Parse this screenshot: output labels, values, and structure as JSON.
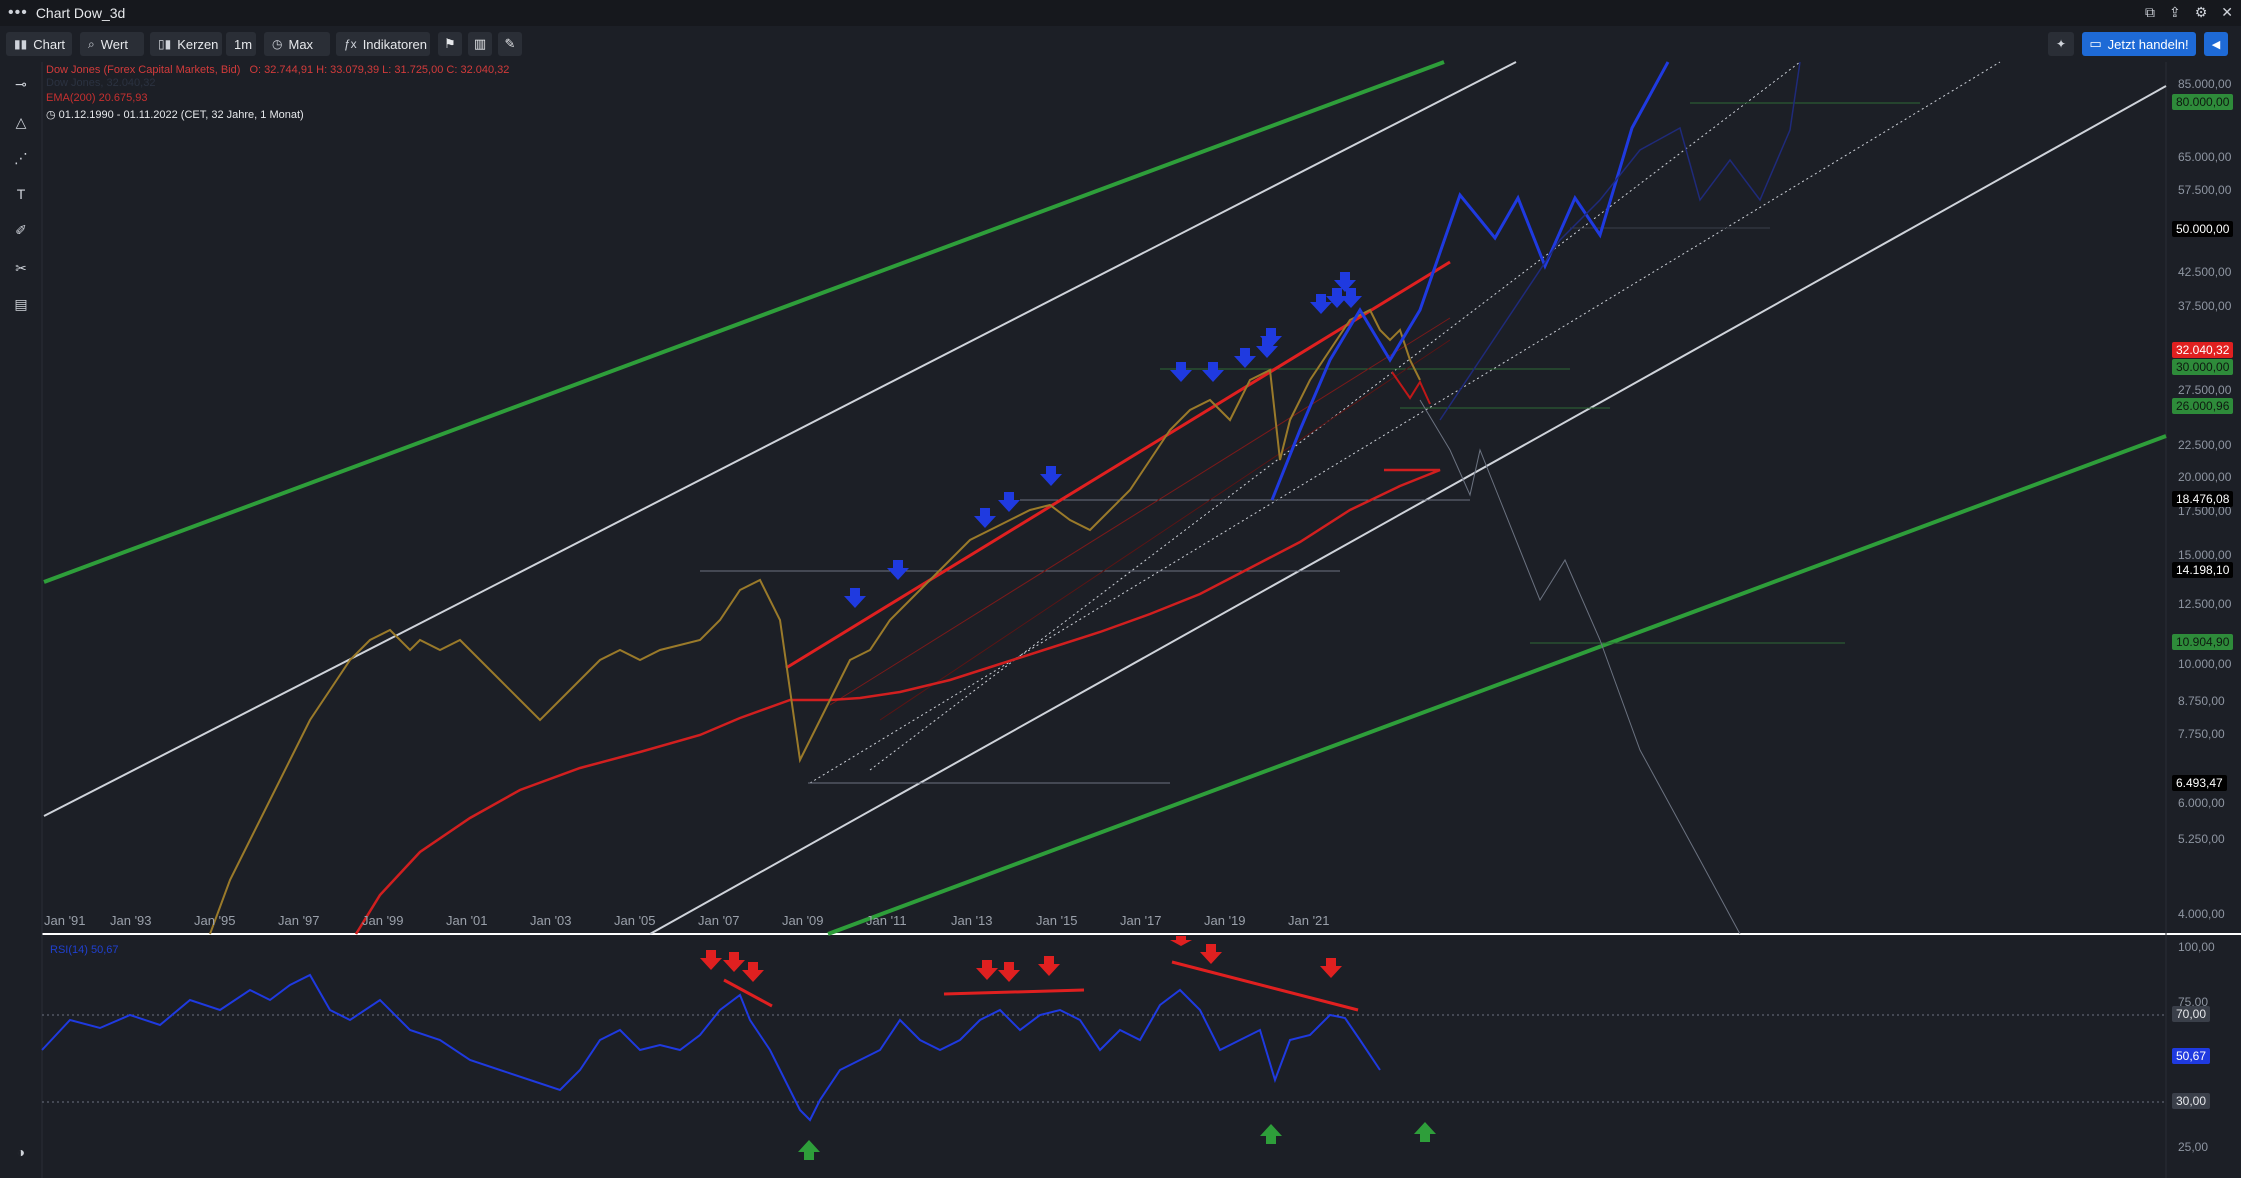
{
  "window": {
    "title": "Chart Dow_3d",
    "menu_glyph": "•••"
  },
  "toolbar": {
    "chart_label": "Chart",
    "wert_label": "Wert",
    "kerzen_label": "Kerzen",
    "interval_label": "1m",
    "range_label": "Max",
    "indikatoren_label": "Indikatoren",
    "trade_label": "Jetzt handeln!"
  },
  "legend": {
    "instrument": "Dow Jones (Forex Capital Markets, Bid)",
    "ohlc": "O: 32.744,91  H: 33.079,39  L: 31.725,00  C: 32.040,32",
    "hidden_row": "Dow Jones, 32.040,32",
    "ema": "EMA(200)  20.675,93",
    "period": "01.12.1990 - 01.11.2022  (CET, 32 Jahre, 1 Monat)",
    "rsi": "RSI(14)  50,67"
  },
  "price_axis": {
    "ticks": [
      "85.000,00",
      "65.000,00",
      "57.500,00",
      "42.500,00",
      "37.500,00",
      "27.500,00",
      "22.500,00",
      "20.000,00",
      "17.500,00",
      "15.000,00",
      "12.500,00",
      "10.000,00",
      "8.750,00",
      "7.750,00",
      "6.000,00",
      "5.250,00",
      "4.000,00"
    ],
    "badges": [
      {
        "value": "80.000,00",
        "kind": "green"
      },
      {
        "value": "50.000,00",
        "kind": "black"
      },
      {
        "value": "32.040,32",
        "kind": "red"
      },
      {
        "value": "30.000,00",
        "kind": "green"
      },
      {
        "value": "26.000,96",
        "kind": "green"
      },
      {
        "value": "18.476,08",
        "kind": "black"
      },
      {
        "value": "14.198,10",
        "kind": "black"
      },
      {
        "value": "10.904,90",
        "kind": "green"
      },
      {
        "value": "6.493,47",
        "kind": "black"
      }
    ]
  },
  "rsi_axis": {
    "ticks": [
      "100,00",
      "75,00",
      "25,00"
    ],
    "badges": [
      {
        "value": "70,00",
        "kind": "grey"
      },
      {
        "value": "50,67",
        "kind": "blue"
      },
      {
        "value": "30,00",
        "kind": "grey"
      }
    ]
  },
  "time_axis": [
    "Jan '91",
    "Jan '93",
    "Jan '95",
    "Jan '97",
    "Jan '99",
    "Jan '01",
    "Jan '03",
    "Jan '05",
    "Jan '07",
    "Jan '09",
    "Jan '11",
    "Jan '13",
    "Jan '15",
    "Jan '17",
    "Jan '19",
    "Jan '21"
  ],
  "colors": {
    "bg": "#1c1f26",
    "green": "#2e9e3a",
    "red": "#e02020",
    "blue": "#1f3ae0",
    "white_line": "#cfd3da"
  },
  "icons": [
    "crosshair-icon",
    "triangle-icon",
    "pattern-icon",
    "text-icon",
    "brush-icon",
    "tools-icon",
    "trash-icon",
    "theme-icon"
  ]
}
